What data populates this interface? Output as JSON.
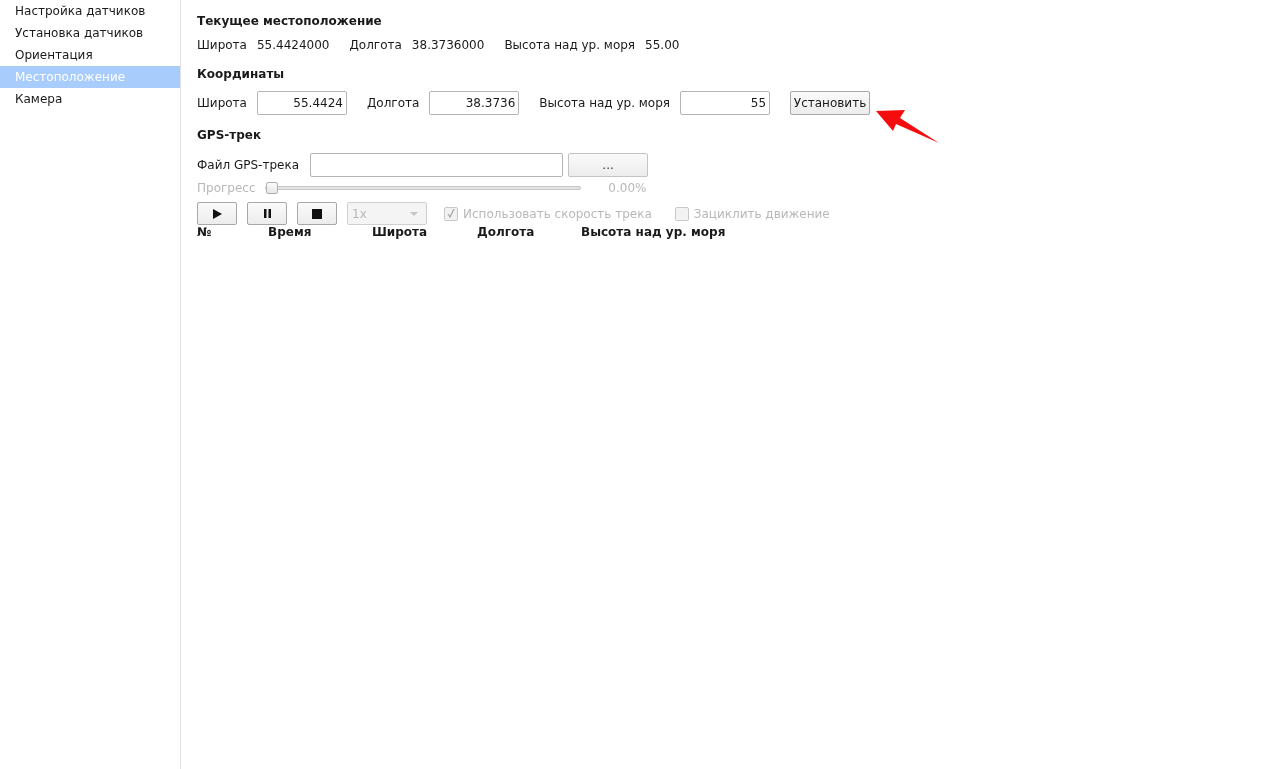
{
  "sidebar": {
    "items": [
      {
        "label": "Настройка датчиков",
        "selected": false
      },
      {
        "label": "Установка датчиков",
        "selected": false
      },
      {
        "label": "Ориентация",
        "selected": false
      },
      {
        "label": "Местоположение",
        "selected": true
      },
      {
        "label": "Камера",
        "selected": false
      }
    ]
  },
  "current_location": {
    "title": "Текущее местоположение",
    "fields": [
      {
        "label": "Широта",
        "value": "55.4424000"
      },
      {
        "label": "Долгота",
        "value": "38.3736000"
      },
      {
        "label": "Высота над ур. моря",
        "value": "55.00"
      }
    ]
  },
  "coordinates": {
    "title": "Координаты",
    "fields": [
      {
        "label": "Широта",
        "value": "55.4424"
      },
      {
        "label": "Долгота",
        "value": "38.3736"
      },
      {
        "label": "Высота над ур. моря",
        "value": "55"
      }
    ],
    "button": "Установить"
  },
  "gps_track": {
    "title": "GPS-трек",
    "file": {
      "label": "Файл GPS-трека"
    },
    "browse_button": "...",
    "progress": {
      "label": "Прогресс",
      "level": 0,
      "reading": "0.00%",
      "disabled": true
    },
    "controls": [
      {
        "kind": "play"
      },
      {
        "kind": "pause"
      },
      {
        "kind": "stop"
      }
    ],
    "speed": {
      "value": "1x",
      "disabled": true
    },
    "options": [
      {
        "label": "Использовать скорость трека",
        "checked": true,
        "disabled": true
      },
      {
        "label": "Зациклить движение",
        "checked": false,
        "disabled": true
      }
    ]
  },
  "table": {
    "columns": [
      "№",
      "Время",
      "Широта",
      "Долгота",
      "Высота над ур. моря"
    ]
  },
  "annotation": {
    "kind": "arrow"
  }
}
